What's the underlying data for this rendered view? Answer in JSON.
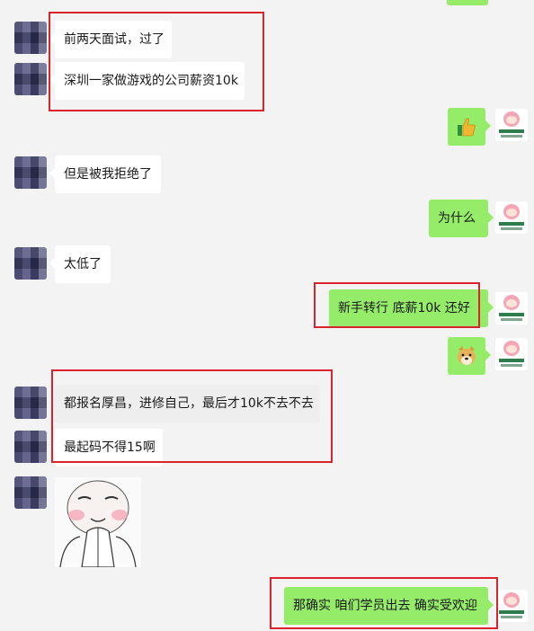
{
  "messages": [
    {
      "side": "in",
      "text": "前两天面试，过了"
    },
    {
      "side": "in",
      "text": "深圳一家做游戏的公司薪资10k"
    },
    {
      "side": "out",
      "emoji": "thumbs-up"
    },
    {
      "side": "in",
      "text": "但是被我拒绝了"
    },
    {
      "side": "out",
      "text": "为什么"
    },
    {
      "side": "in",
      "text": "太低了"
    },
    {
      "side": "out",
      "text": "新手转行 底薪10k  还好"
    },
    {
      "side": "out",
      "emoji": "doge"
    },
    {
      "side": "in",
      "text": "都报名厚昌，进修自己，最后才10k不去不去"
    },
    {
      "side": "in",
      "text": "最起码不得15啊"
    },
    {
      "side": "in",
      "sticker": "meme-face-praying"
    },
    {
      "side": "out",
      "text": "那确实 咱们学员出去 确实受欢迎"
    }
  ],
  "colors": {
    "background": "#f3f3f3",
    "incoming_bubble": "#ffffff",
    "outgoing_bubble": "#95ec69",
    "highlight_box": "#d9232d"
  }
}
